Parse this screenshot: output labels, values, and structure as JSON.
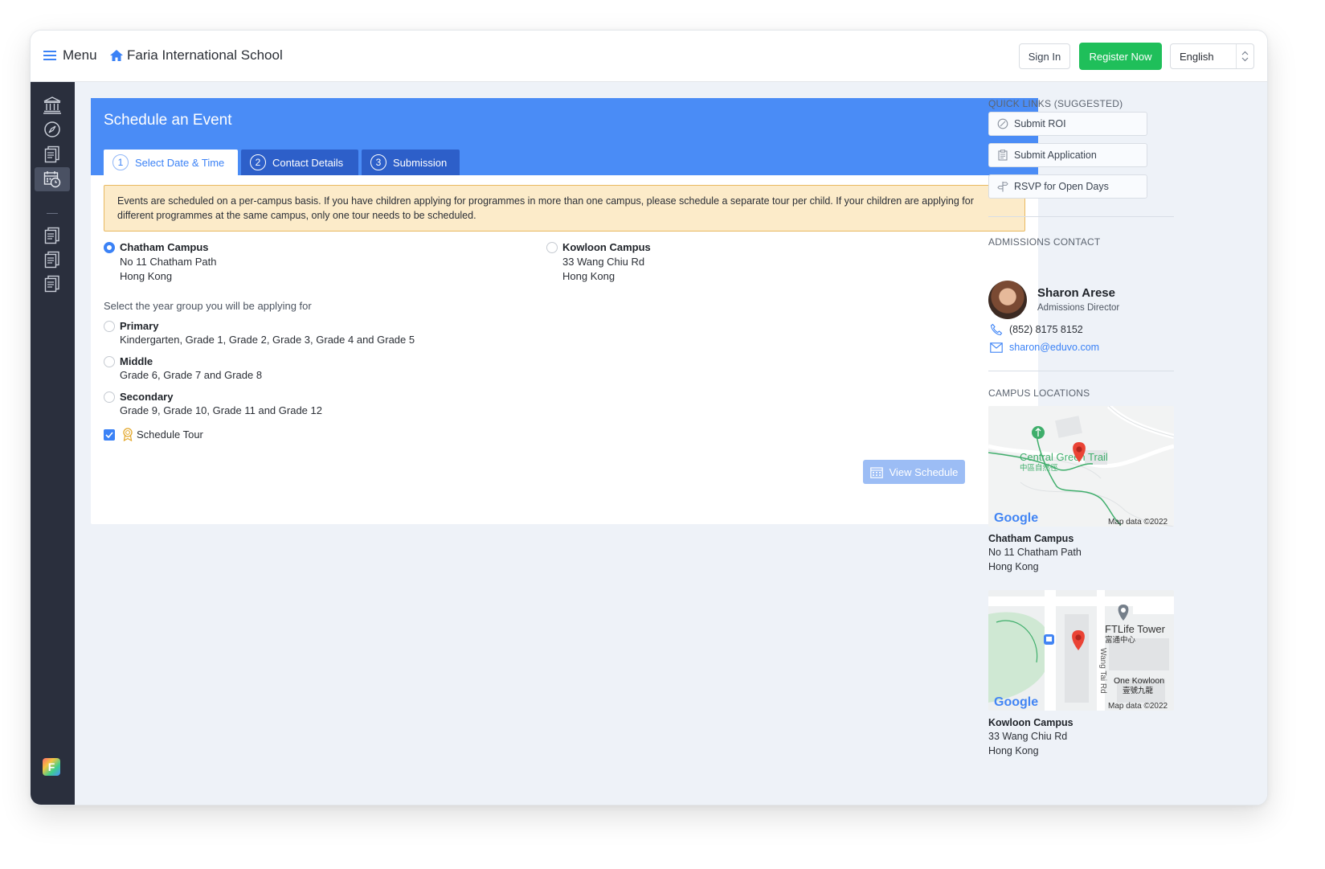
{
  "topbar": {
    "menu_label": "Menu",
    "school_name": "Faria International School",
    "sign_in": "Sign In",
    "register": "Register Now",
    "language": "English"
  },
  "sidebar": {
    "icons": [
      "institution-icon",
      "compass-icon",
      "documents-icon",
      "calendar-clock-icon",
      "documents-icon",
      "documents-icon",
      "documents-icon"
    ],
    "active_index": 3,
    "logo": "F"
  },
  "form": {
    "title": "Schedule an Event",
    "tabs": [
      {
        "num": "1",
        "label": "Select Date & Time"
      },
      {
        "num": "2",
        "label": "Contact Details"
      },
      {
        "num": "3",
        "label": "Submission"
      }
    ],
    "notice": "Events are scheduled on a per-campus basis. If you have children applying for programmes in more than one campus, please schedule a separate tour per child. If your children are applying for different programmes at the same campus, only one tour needs to be scheduled.",
    "campuses": [
      {
        "name": "Chatham Campus",
        "line1": "No 11 Chatham Path",
        "line2": "Hong Kong",
        "selected": true
      },
      {
        "name": "Kowloon Campus",
        "line1": "33 Wang Chiu Rd",
        "line2": "Hong Kong",
        "selected": false
      }
    ],
    "year_prompt": "Select the year group you will be applying for",
    "year_groups": [
      {
        "name": "Primary",
        "grades": "Kindergarten, Grade 1, Grade 2, Grade 3, Grade 4 and Grade 5"
      },
      {
        "name": "Middle",
        "grades": "Grade 6, Grade 7 and Grade 8"
      },
      {
        "name": "Secondary",
        "grades": "Grade 9, Grade 10, Grade 11 and Grade 12"
      }
    ],
    "schedule_tour": "Schedule Tour",
    "view_schedule": "View Schedule"
  },
  "right": {
    "quick_links_header": "QUICK LINKS (SUGGESTED)",
    "quick_links": [
      {
        "icon": "slash-circle-icon",
        "label": "Submit ROI"
      },
      {
        "icon": "clipboard-icon",
        "label": "Submit Application"
      },
      {
        "icon": "signpost-icon",
        "label": "RSVP for Open Days"
      }
    ],
    "admissions_header": "ADMISSIONS CONTACT",
    "contact": {
      "name": "Sharon Arese",
      "role": "Admissions Director",
      "phone": "(852) 8175 8152",
      "email": "sharon@eduvo.com"
    },
    "locations_header": "CAMPUS LOCATIONS",
    "maps": [
      {
        "google": "Google",
        "credit": "Map data ©2022",
        "label_main": "Central Green Trail",
        "label_sub": "中區自然徑",
        "campus": "Chatham Campus",
        "line1": "No 11 Chatham Path",
        "line2": "Hong Kong"
      },
      {
        "google": "Google",
        "credit": "Map data ©2022",
        "label_main": "FTLife Tower",
        "label_sub": "富通中心",
        "label_road": "Wang Tai Rd",
        "label_poi": "One Kowloon",
        "label_poi_sub": "壹號九龍",
        "campus": "Kowloon Campus",
        "line1": "33 Wang Chiu Rd",
        "line2": "Hong Kong"
      }
    ]
  },
  "colors": {
    "primary": "#4a8cf6",
    "tab_inactive": "#2d5fc9",
    "register_green": "#1fbf5a",
    "sidebar_bg": "#2a2f3d",
    "notice_bg": "#fcebc9",
    "notice_border": "#e8b962",
    "map_pin": "#ea4335"
  }
}
